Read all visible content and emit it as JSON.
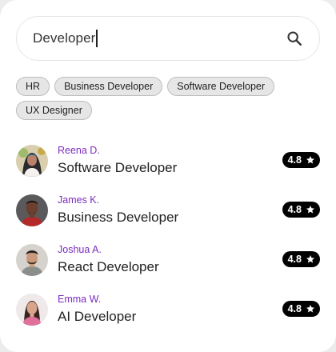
{
  "search": {
    "value": "Developer",
    "icon": "search-icon"
  },
  "chips": [
    {
      "label": "HR"
    },
    {
      "label": "Business Developer"
    },
    {
      "label": "Software Developer"
    },
    {
      "label": "UX Designer"
    }
  ],
  "people": [
    {
      "name": "Reena D.",
      "role": "Software Developer",
      "rating": "4.8"
    },
    {
      "name": "James K.",
      "role": "Business Developer",
      "rating": "4.8"
    },
    {
      "name": "Joshua A.",
      "role": "React Developer",
      "rating": "4.8"
    },
    {
      "name": "Emma W.",
      "role": "AI Developer",
      "rating": "4.8"
    }
  ],
  "colors": {
    "name_accent": "#7b2cbf",
    "rating_badge": "#000000",
    "chip_background": "#e6e6e6"
  }
}
